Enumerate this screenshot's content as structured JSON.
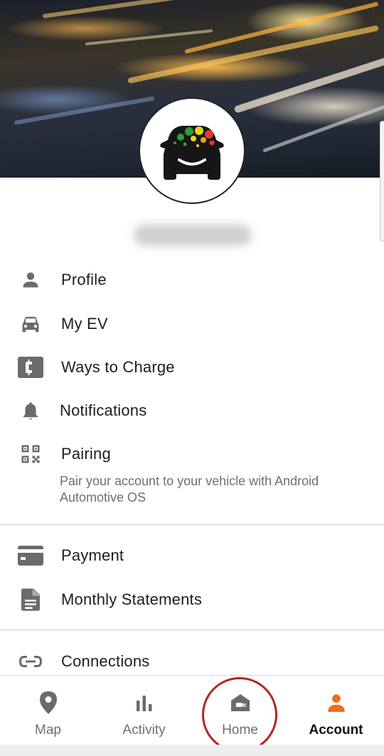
{
  "header": {
    "username": "adammalkin"
  },
  "menu": {
    "profile": "Profile",
    "my_ev": "My EV",
    "ways_to_charge": "Ways to Charge",
    "notifications": "Notifications",
    "pairing": "Pairing",
    "pairing_desc": "Pair your account to your vehicle with Android Automotive OS",
    "payment": "Payment",
    "monthly_statements": "Monthly Statements",
    "connections": "Connections"
  },
  "nav": {
    "map": "Map",
    "activity": "Activity",
    "home": "Home",
    "account": "Account",
    "active": "account"
  },
  "colors": {
    "accent": "#f26b1d",
    "icon_gray": "#6b6b6b",
    "highlight_ring": "#b3261e"
  },
  "icons": {
    "profile": "person-icon",
    "my_ev": "car-icon",
    "ways_to_charge": "charge-card-icon",
    "notifications": "bell-icon",
    "pairing": "qr-code-icon",
    "payment": "credit-card-icon",
    "monthly_statements": "document-icon",
    "connections": "link-icon",
    "map": "map-pin-icon",
    "activity": "bar-chart-icon",
    "home": "home-charger-icon",
    "account": "person-icon"
  }
}
